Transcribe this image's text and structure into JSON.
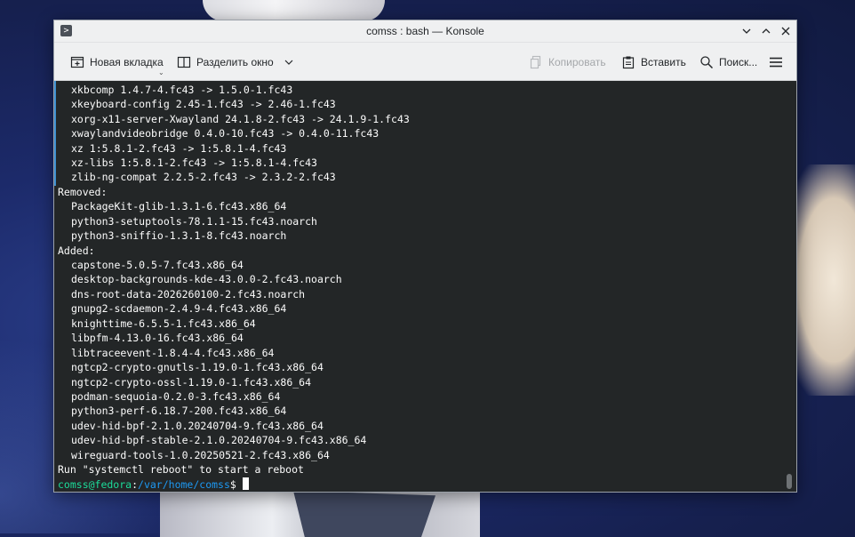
{
  "window": {
    "title": "comss : bash — Konsole"
  },
  "toolbar": {
    "new_tab_label": "Новая вкладка",
    "split_label": "Разделить окно",
    "copy_label": "Копировать",
    "paste_label": "Вставить",
    "search_label": "Поиск..."
  },
  "terminal": {
    "upgraded": [
      "xkbcomp 1.4.7-4.fc43 -> 1.5.0-1.fc43",
      "xkeyboard-config 2.45-1.fc43 -> 2.46-1.fc43",
      "xorg-x11-server-Xwayland 24.1.8-2.fc43 -> 24.1.9-1.fc43",
      "xwaylandvideobridge 0.4.0-10.fc43 -> 0.4.0-11.fc43",
      "xz 1:5.8.1-2.fc43 -> 1:5.8.1-4.fc43",
      "xz-libs 1:5.8.1-2.fc43 -> 1:5.8.1-4.fc43",
      "zlib-ng-compat 2.2.5-2.fc43 -> 2.3.2-2.fc43"
    ],
    "removed_header": "Removed:",
    "removed": [
      "PackageKit-glib-1.3.1-6.fc43.x86_64",
      "python3-setuptools-78.1.1-15.fc43.noarch",
      "python3-sniffio-1.3.1-8.fc43.noarch"
    ],
    "added_header": "Added:",
    "added": [
      "capstone-5.0.5-7.fc43.x86_64",
      "desktop-backgrounds-kde-43.0.0-2.fc43.noarch",
      "dns-root-data-2026260100-2.fc43.noarch",
      "gnupg2-scdaemon-2.4.9-4.fc43.x86_64",
      "knighttime-6.5.5-1.fc43.x86_64",
      "libpfm-4.13.0-16.fc43.x86_64",
      "libtraceevent-1.8.4-4.fc43.x86_64",
      "ngtcp2-crypto-gnutls-1.19.0-1.fc43.x86_64",
      "ngtcp2-crypto-ossl-1.19.0-1.fc43.x86_64",
      "podman-sequoia-0.2.0-3.fc43.x86_64",
      "python3-perf-6.18.7-200.fc43.x86_64",
      "udev-hid-bpf-2.1.0.20240704-9.fc43.x86_64",
      "udev-hid-bpf-stable-2.1.0.20240704-9.fc43.x86_64",
      "wireguard-tools-1.0.20250521-2.fc43.x86_64"
    ],
    "reboot_message": "Run \"systemctl reboot\" to start a reboot",
    "prompt_user": "comss@fedora",
    "prompt_sep": ":",
    "prompt_path": "/var/home/comss",
    "prompt_symbol": "$"
  },
  "colors": {
    "terminal_bg": "#232627",
    "terminal_fg": "#fcfcfc",
    "prompt_user": "#1cdc9a",
    "prompt_path": "#1d99f3"
  }
}
